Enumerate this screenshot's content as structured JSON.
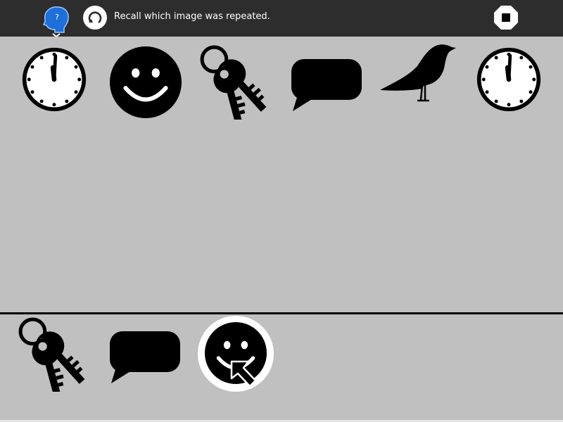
{
  "header": {
    "instruction": "Recall which image was repeated.",
    "activity_icon": "brain-question-icon",
    "restart_icon": "refresh-icon",
    "stop_icon": "stop-icon"
  },
  "sequence": {
    "items": [
      {
        "icon": "clock-icon"
      },
      {
        "icon": "smiley-icon"
      },
      {
        "icon": "keys-icon"
      },
      {
        "icon": "speech-bubble-icon"
      },
      {
        "icon": "crow-icon"
      },
      {
        "icon": "clock-icon"
      }
    ]
  },
  "choices": {
    "items": [
      {
        "icon": "keys-icon"
      },
      {
        "icon": "speech-bubble-icon"
      },
      {
        "icon": "smiley-icon",
        "highlighted": true
      }
    ]
  },
  "colors": {
    "topbar": "#2d2d2d",
    "canvas": "#c0c0c0",
    "highlight": "#ffffff",
    "activity_blue": "#1e6fd9"
  }
}
